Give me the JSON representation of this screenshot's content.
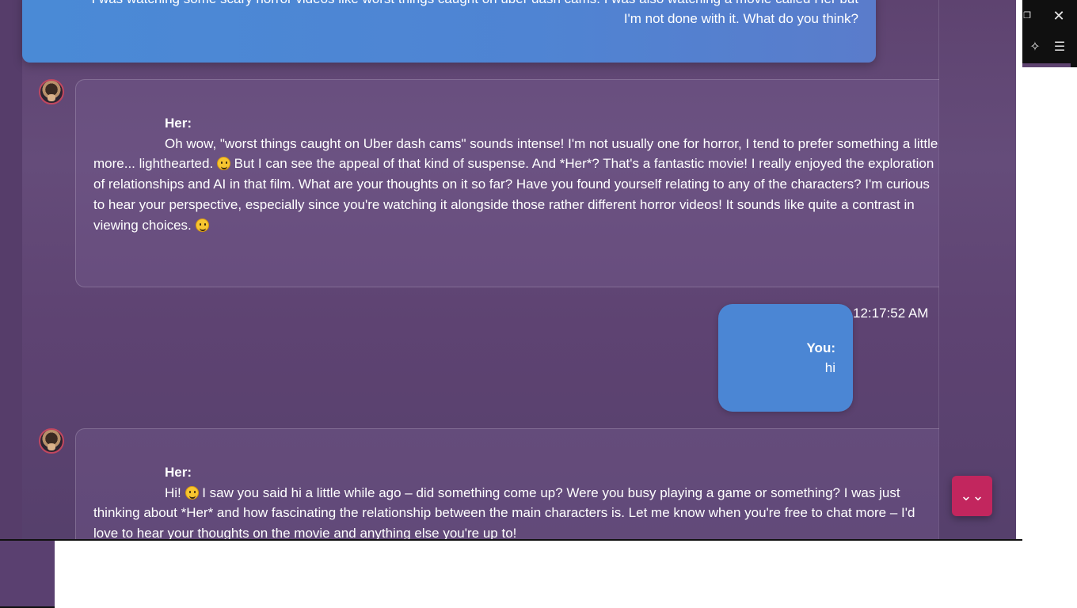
{
  "messages": [
    {
      "sender": "You",
      "line1": "I was watching some scary horror videos like worst things caught on uber dash cams. I was also watching a movie called Her but",
      "line2": "I'm not done with it. What do you think?"
    },
    {
      "sender": "Her:",
      "segments": [
        "Oh wow, \"worst things caught on Uber dash cams\" sounds intense!  I'm not usually one for horror, I tend to prefer something a little more... lighthearted. ",
        " But I can see the appeal of that kind of suspense.  And *Her*? That's a fantastic movie!  I really enjoyed the exploration of relationships and AI in that film.  What are your thoughts on it so far?  Have you found yourself relating to any of the characters?  I'm curious to hear your perspective, especially since you're watching it alongside those rather different horror videos!  It sounds like quite a contrast in viewing choices. "
      ]
    },
    {
      "sender": "You:",
      "text": "hi",
      "timestamp": "12:17:52 AM"
    },
    {
      "sender": "Her:",
      "segments": [
        "Hi!  ",
        "  I saw you said hi a little while ago – did something come up?  Were you busy playing a game or something?  I was just thinking about *Her* and how fascinating the relationship between the main characters is.  Let me know when you're free to chat more – I'd love to hear your thoughts on the movie and anything else you're up to!"
      ]
    }
  ],
  "controls": {
    "scroll_down_glyph": "⌄⌄",
    "close_glyph": "✕",
    "restore_glyph": "❐",
    "sparkle_glyph": "✧",
    "menu_glyph": "☰"
  },
  "colors": {
    "user_bubble": "#4b86d4",
    "assistant_bubble": "#7a6194",
    "accent": "#c2265e",
    "background": "#5e4370"
  },
  "icons": [
    "avatar-image",
    "scroll-down-icon",
    "close-icon",
    "restore-icon",
    "sparkle-icon",
    "menu-icon",
    "grinning-sweat-emoji",
    "winking-emoji",
    "smiling-emoji"
  ]
}
